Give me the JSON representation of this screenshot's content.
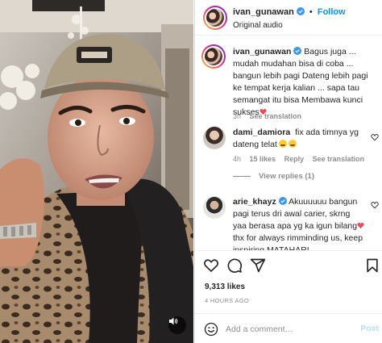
{
  "post": {
    "author": "ivan_gunawan",
    "follow_label": "Follow",
    "audio": "Original audio"
  },
  "caption": {
    "username": "ivan_gunawan",
    "text": "Bagus juga ... mudah mudahan bisa di coba ... bangun lebih pagi Dateng lebih pagi ke tempat kerja kalian ... sapa tau semangat itu bisa Membawa kunci sukses",
    "time": "3h",
    "see_translation": "See translation"
  },
  "comments": [
    {
      "username": "dami_damiora",
      "text": "fix ada timnya yg dateng telat",
      "time": "4h",
      "likes": "15 likes",
      "reply": "Reply",
      "see_translation": "See translation",
      "view_replies": "View replies (1)"
    },
    {
      "username": "arie_khayz",
      "text": "Akuuuuuu bangun pagi terus dri awal carier, skrng yaa berasa apa yg ka igun bilang",
      "text2": "thx for always rimminding us, keep inspiring MATAHARI"
    }
  ],
  "actions": {
    "like_icon": "heart-icon",
    "comment_icon": "comment-icon",
    "share_icon": "share-icon",
    "save_icon": "bookmark-icon"
  },
  "likes": "9,313 likes",
  "time_ago": "4 HOURS AGO",
  "add_comment": {
    "placeholder": "Add a comment…",
    "post_label": "Post"
  },
  "colors": {
    "link_blue": "#0095f6",
    "verified": "#3897f0",
    "heart_red": "#ed4956",
    "muted": "#8e8e8e"
  }
}
